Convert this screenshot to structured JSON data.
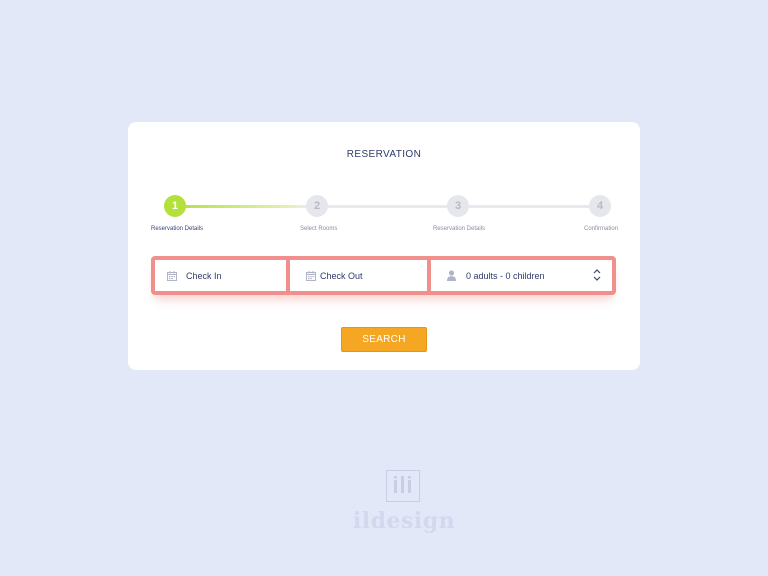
{
  "card": {
    "title": "RESERVATION"
  },
  "steps": [
    {
      "number": "1",
      "label": "Reservation Details",
      "active": true
    },
    {
      "number": "2",
      "label": "Select Rooms",
      "active": false
    },
    {
      "number": "3",
      "label": "Reservation Details",
      "active": false
    },
    {
      "number": "4",
      "label": "Confirmation",
      "active": false
    }
  ],
  "form": {
    "check_in": {
      "label": "Check In",
      "icon": "calendar-icon"
    },
    "check_out": {
      "label": "Check Out",
      "icon": "calendar-icon"
    },
    "guests": {
      "value": "0 adults - 0 children",
      "icon": "user-icon"
    }
  },
  "search_button": {
    "label": "SEARCH"
  },
  "logo": {
    "text": "ildesign"
  },
  "colors": {
    "background": "#e3e8f8",
    "step_active": "#b3e03a",
    "form_border": "#f08f8b",
    "search_button": "#f5a623",
    "title_text": "#2f3a6b"
  }
}
